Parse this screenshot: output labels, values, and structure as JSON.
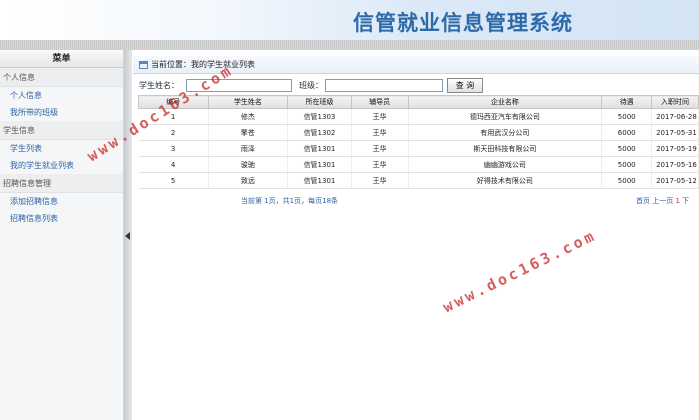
{
  "header": {
    "title": "信管就业信息管理系统"
  },
  "sidebar": {
    "title": "菜单",
    "groups": [
      {
        "label": "个人信息",
        "items": [
          {
            "label": "个人信息"
          },
          {
            "label": "我所带的班级"
          }
        ]
      },
      {
        "label": "学生信息",
        "items": [
          {
            "label": "学生列表"
          },
          {
            "label": "我的学生就业列表"
          }
        ]
      },
      {
        "label": "招聘信息管理",
        "items": [
          {
            "label": "添加招聘信息"
          },
          {
            "label": "招聘信息列表"
          }
        ]
      }
    ]
  },
  "breadcrumb": {
    "text": "当前位置：我的学生就业列表"
  },
  "search": {
    "name_label": "学生姓名：",
    "name_value": "",
    "class_label": "班级：",
    "class_value": "",
    "button": "查 询"
  },
  "table": {
    "columns": [
      "编号",
      "学生姓名",
      "所在班级",
      "辅导员",
      "企业名称",
      "待遇",
      "入职时间"
    ],
    "rows": [
      [
        "1",
        "修杰",
        "信管1303",
        "王华",
        "德玛西亚汽车有限公司",
        "5000",
        "2017-06-28"
      ],
      [
        "2",
        "擎苍",
        "信管1302",
        "王华",
        "有用武汉分公司",
        "6000",
        "2017-05-31"
      ],
      [
        "3",
        "雨泽",
        "信管1301",
        "王华",
        "斯天田科技有限公司",
        "5000",
        "2017-05-19"
      ],
      [
        "4",
        "骏驰",
        "信管1301",
        "王华",
        "幽幽游戏公司",
        "5000",
        "2017-05-16"
      ],
      [
        "5",
        "致远",
        "信管1301",
        "王华",
        "好得技术有限公司",
        "5000",
        "2017-05-12"
      ]
    ]
  },
  "pager": {
    "summary": "当前第 1页，共1页，每页18条",
    "links": [
      "首页",
      "上一页",
      "1",
      "下"
    ]
  },
  "watermark": {
    "text": "www.doc163.com"
  },
  "colors": {
    "title": "#2f6aa8",
    "link": "#2a62a6",
    "watermark": "#c82828"
  }
}
